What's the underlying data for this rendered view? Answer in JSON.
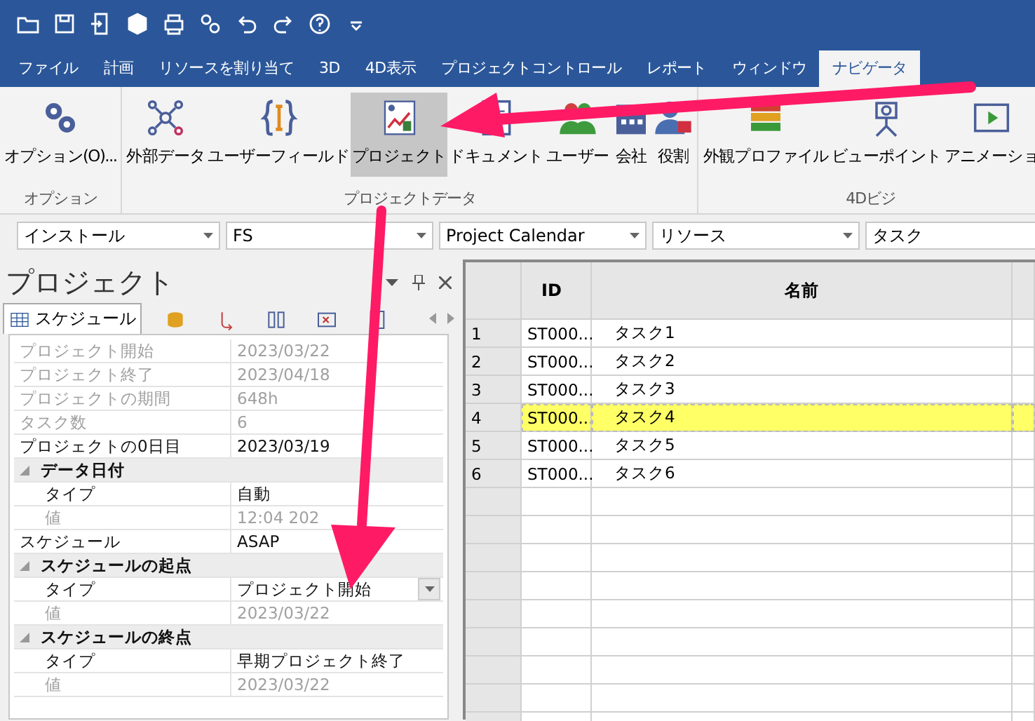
{
  "ribbon_tabs": [
    {
      "label": "ファイル",
      "selected": false
    },
    {
      "label": "計画",
      "selected": false
    },
    {
      "label": "リソースを割り当て",
      "selected": false
    },
    {
      "label": "3D",
      "selected": false
    },
    {
      "label": "4D表示",
      "selected": false
    },
    {
      "label": "プロジェクトコントロール",
      "selected": false
    },
    {
      "label": "レポート",
      "selected": false
    },
    {
      "label": "ウィンドウ",
      "selected": false
    },
    {
      "label": "ナビゲータ",
      "selected": true
    }
  ],
  "ribbon_groups": [
    {
      "label": "オプション",
      "buttons": [
        {
          "label": "オプション(O)...",
          "selected": false
        }
      ]
    },
    {
      "label": "プロジェクトデータ",
      "buttons": [
        {
          "label": "外部データ",
          "selected": false
        },
        {
          "label": "ユーザーフィールド",
          "selected": false
        },
        {
          "label": "プロジェクト",
          "selected": true
        },
        {
          "label": "ドキュメント",
          "selected": false
        },
        {
          "label": "ユーザー",
          "selected": false
        },
        {
          "label": "会社",
          "selected": false
        },
        {
          "label": "役割",
          "selected": false
        }
      ]
    },
    {
      "label": "4Dビジ",
      "buttons": [
        {
          "label": "外観プロファイル",
          "selected": false
        },
        {
          "label": "ビューポイント",
          "selected": false
        },
        {
          "label": "アニメーショ",
          "selected": false
        }
      ]
    }
  ],
  "filters": [
    "インストール",
    "FS",
    "Project Calendar",
    "リソース",
    "タスク"
  ],
  "panel": {
    "title": "プロジェクト",
    "tabs": [
      {
        "label": "スケジュール",
        "selected": true
      },
      {
        "selected": false
      },
      {
        "selected": false
      },
      {
        "selected": false
      },
      {
        "selected": false
      },
      {
        "selected": false
      }
    ],
    "properties": [
      {
        "kind": "prop",
        "label": "プロジェクト開始",
        "value": "2023/03/22",
        "disabled": true
      },
      {
        "kind": "prop",
        "label": "プロジェクト終了",
        "value": "2023/04/18",
        "disabled": true
      },
      {
        "kind": "prop",
        "label": "プロジェクトの期間",
        "value": "648h",
        "disabled": true
      },
      {
        "kind": "prop",
        "label": "タスク数",
        "value": "6",
        "disabled": true
      },
      {
        "kind": "prop",
        "label": "プロジェクトの0日目",
        "value": "2023/03/19",
        "disabled": false
      },
      {
        "kind": "group",
        "label": "データ日付",
        "expanded": true,
        "children": [
          {
            "kind": "prop",
            "label": "タイプ",
            "value": "自動",
            "disabled": false
          },
          {
            "kind": "prop",
            "label": "値",
            "value": "12:04 202",
            "disabled": true
          }
        ]
      },
      {
        "kind": "prop",
        "label": "スケジュール",
        "value": "ASAP",
        "disabled": false
      },
      {
        "kind": "group",
        "label": "スケジュールの起点",
        "expanded": true,
        "children": [
          {
            "kind": "dropdown",
            "label": "タイプ",
            "value": "プロジェクト開始",
            "disabled": false
          },
          {
            "kind": "prop",
            "label": "値",
            "value": "2023/03/22",
            "disabled": true
          }
        ]
      },
      {
        "kind": "group",
        "label": "スケジュールの終点",
        "expanded": true,
        "children": [
          {
            "kind": "prop",
            "label": "タイプ",
            "value": "早期プロジェクト終了",
            "disabled": false
          },
          {
            "kind": "prop",
            "label": "値",
            "value": "2023/03/22",
            "disabled": true
          }
        ]
      }
    ]
  },
  "table": {
    "columns": [
      "ID",
      "名前"
    ],
    "rows": [
      {
        "number": "1",
        "id": "ST000...",
        "name": "タスク1",
        "selected": false
      },
      {
        "number": "2",
        "id": "ST000...",
        "name": "タスク2",
        "selected": false
      },
      {
        "number": "3",
        "id": "ST000...",
        "name": "タスク3",
        "selected": false
      },
      {
        "number": "4",
        "id": "ST000...",
        "name": "タスク4",
        "selected": true
      },
      {
        "number": "5",
        "id": "ST000...",
        "name": "タスク5",
        "selected": false
      },
      {
        "number": "6",
        "id": "ST000...",
        "name": "タスク6",
        "selected": false
      }
    ]
  }
}
